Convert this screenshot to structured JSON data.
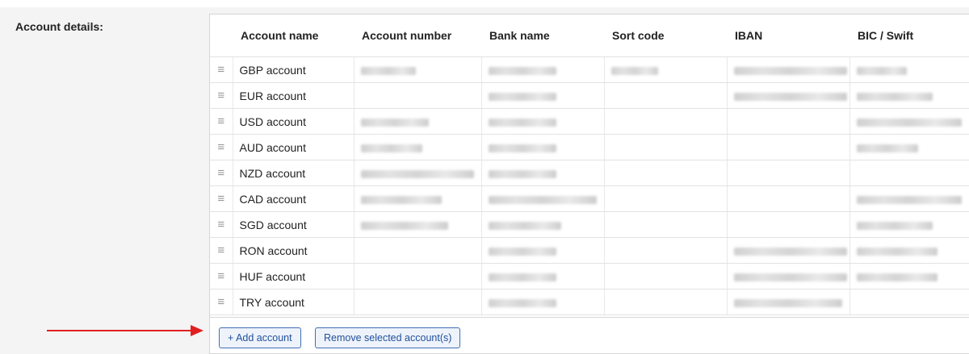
{
  "section_label": "Account details:",
  "table": {
    "columns": [
      "Account name",
      "Account number",
      "Bank name",
      "Sort code",
      "IBAN",
      "BIC / Swift"
    ],
    "handle_glyph": "≡",
    "rows": [
      {
        "name": "GBP account"
      },
      {
        "name": "EUR account"
      },
      {
        "name": "USD account"
      },
      {
        "name": "AUD account"
      },
      {
        "name": "NZD account"
      },
      {
        "name": "CAD account"
      },
      {
        "name": "SGD account"
      },
      {
        "name": "RON account"
      },
      {
        "name": "HUF account"
      },
      {
        "name": "TRY account"
      }
    ]
  },
  "buttons": {
    "add_account": "+ Add account",
    "remove_selected": "Remove selected account(s)"
  },
  "colors": {
    "button_border": "#3f6fb5",
    "button_text": "#1f4f9a",
    "arrow": "#e02020"
  }
}
